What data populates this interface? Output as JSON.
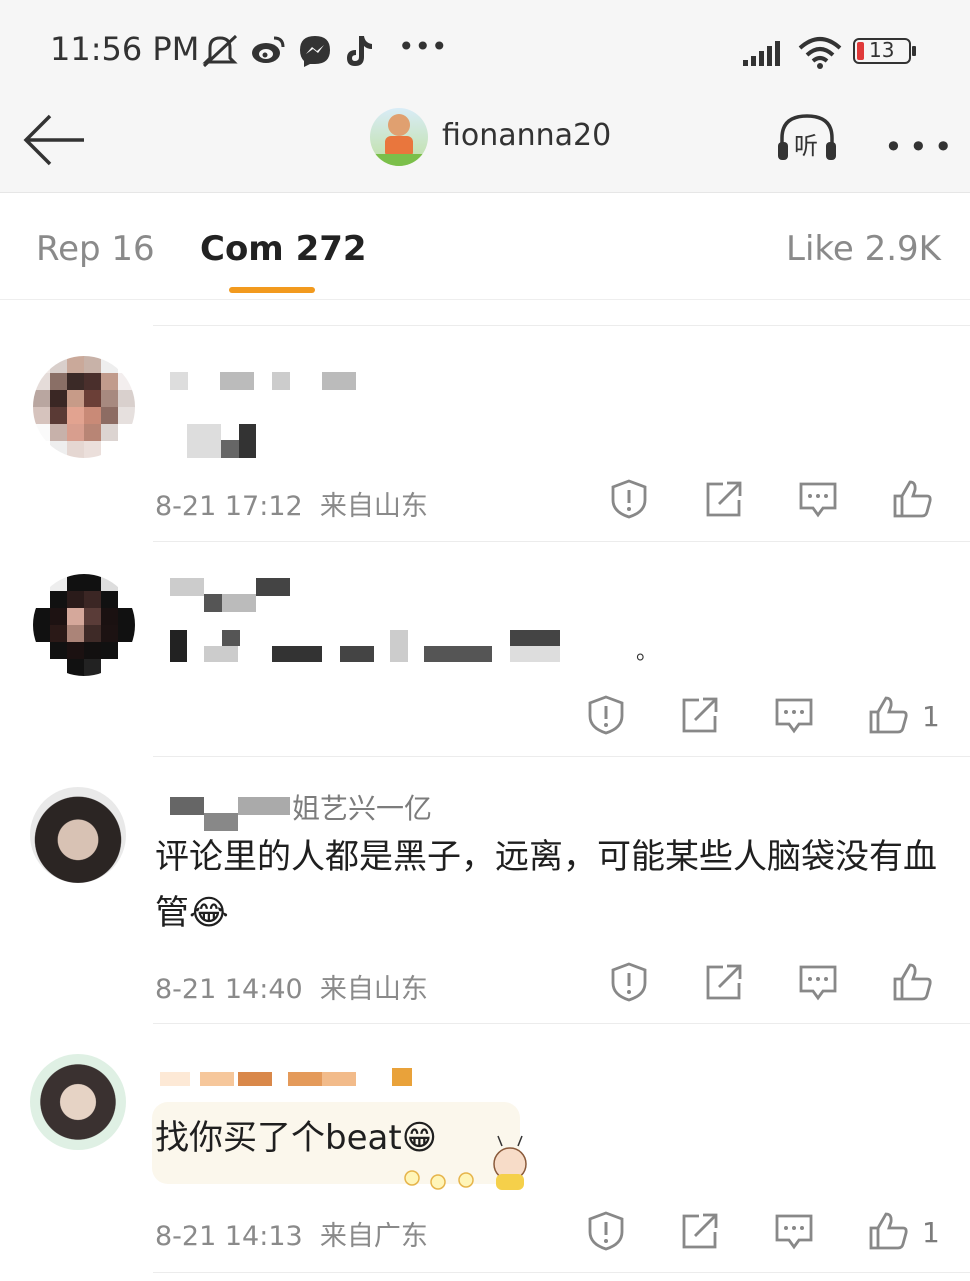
{
  "status_bar": {
    "time": "11:56 PM",
    "battery": "13",
    "icons": [
      "mute-icon",
      "weibo-icon",
      "messenger-icon",
      "tiktok-icon",
      "more-dots-icon",
      "signal-icon",
      "wifi-icon",
      "battery-icon"
    ]
  },
  "header": {
    "username": "fionanna20",
    "listen_label": "听",
    "more_label": "•••"
  },
  "tabs": [
    {
      "label": "Rep 16",
      "active": false
    },
    {
      "label": "Com 272",
      "active": true
    },
    {
      "label": "Like 2.9K",
      "active": false
    }
  ],
  "comments": [
    {
      "name": "",
      "text": "",
      "time": "8-21 17:12",
      "location": "来自山东",
      "likes": ""
    },
    {
      "name": "",
      "text": "。",
      "time": "",
      "location": "",
      "likes": "1"
    },
    {
      "name": "姐艺兴一亿",
      "text": "评论里的人都是黑子，远离，可能某些人脑袋没有血管",
      "emoji": "😂",
      "time": "8-21 14:40",
      "location": "来自山东",
      "likes": ""
    },
    {
      "name": "",
      "text": "找你买了个beat",
      "emoji": "😁",
      "time": "8-21 14:13",
      "location": "来自广东",
      "likes": "1"
    }
  ],
  "colors": {
    "accent": "#f29a1e",
    "meta": "#8a8a8a"
  }
}
